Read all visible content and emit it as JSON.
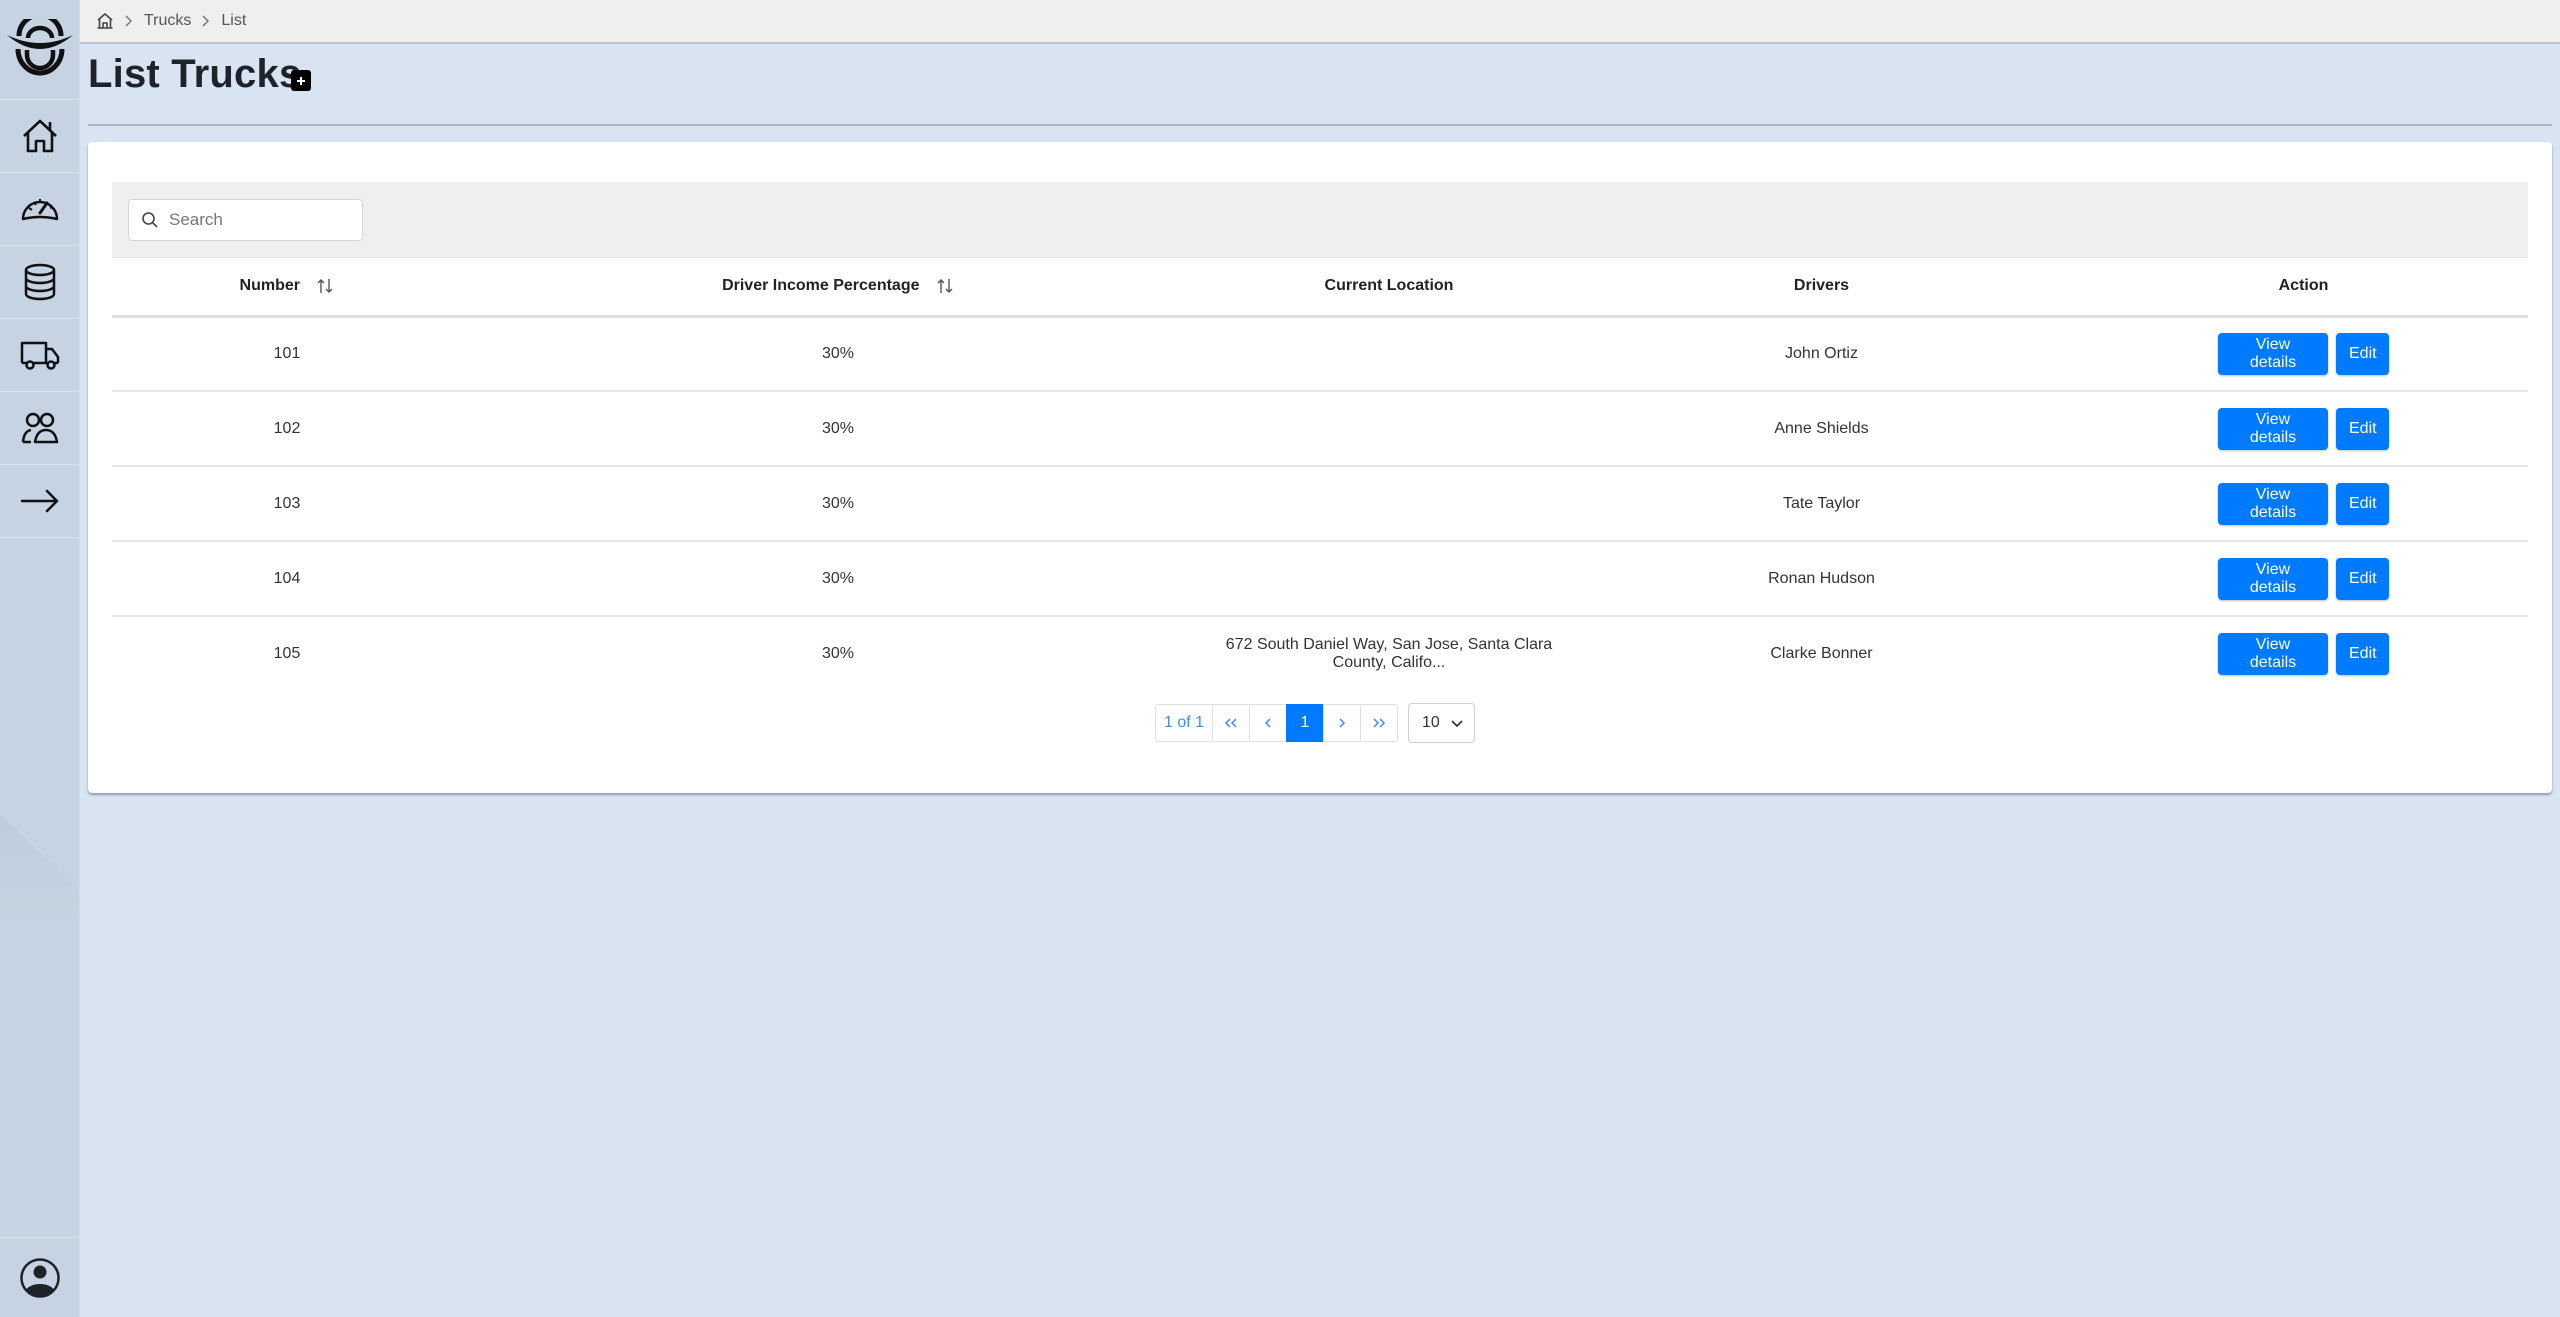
{
  "breadcrumb": {
    "home_icon": "home-icon",
    "items": [
      "Trucks",
      "List"
    ]
  },
  "header": {
    "title": "List Trucks",
    "add_icon": "plus-square-icon"
  },
  "sidebar": {
    "logo": "company-logo",
    "items": [
      {
        "name": "home",
        "icon": "home-icon"
      },
      {
        "name": "dashboard",
        "icon": "speedometer-icon"
      },
      {
        "name": "database",
        "icon": "database-icon"
      },
      {
        "name": "trucks",
        "icon": "truck-icon"
      },
      {
        "name": "users",
        "icon": "people-icon"
      },
      {
        "name": "logout",
        "icon": "arrow-right-icon"
      }
    ],
    "profile_icon": "user-circle-icon"
  },
  "search": {
    "placeholder": "Search",
    "value": ""
  },
  "table": {
    "columns": [
      "Number",
      "Driver Income Percentage",
      "Current Location",
      "Drivers",
      "Action"
    ],
    "rows": [
      {
        "number": "101",
        "income": "30%",
        "location": "",
        "driver": "John Ortiz"
      },
      {
        "number": "102",
        "income": "30%",
        "location": "",
        "driver": "Anne Shields"
      },
      {
        "number": "103",
        "income": "30%",
        "location": "",
        "driver": "Tate Taylor"
      },
      {
        "number": "104",
        "income": "30%",
        "location": "",
        "driver": "Ronan Hudson"
      },
      {
        "number": "105",
        "income": "30%",
        "location": "672 South Daniel Way, San Jose, Santa Clara County, Califo...",
        "driver": "Clarke Bonner"
      }
    ],
    "actions": {
      "view": "View details",
      "edit": "Edit"
    }
  },
  "pagination": {
    "summary": "1 of 1",
    "first": "<<",
    "prev": "<",
    "current": "1",
    "next": ">",
    "last": ">>",
    "page_size": "10"
  },
  "colors": {
    "primary": "#007bff",
    "background": "#d9e4f2",
    "sidebar": "#c5d3e2"
  }
}
